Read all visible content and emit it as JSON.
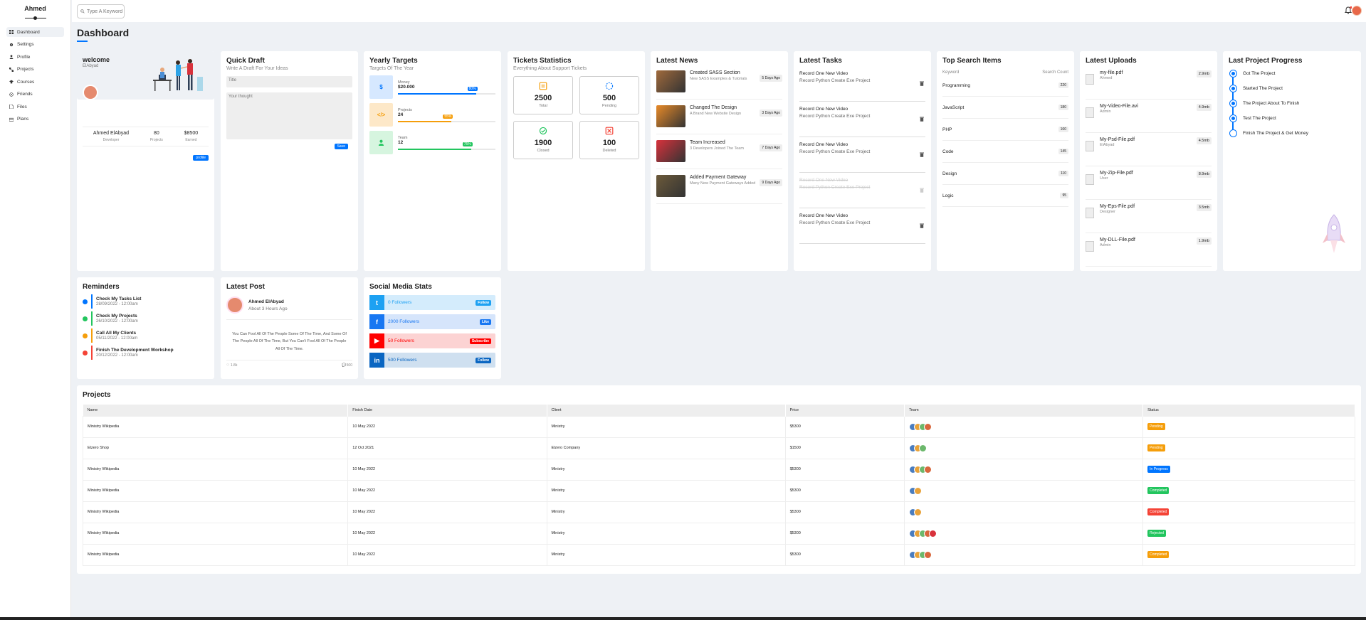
{
  "sidebar": {
    "brand": "Ahmed",
    "items": [
      {
        "label": "Dashboard",
        "icon": "dashboard-icon"
      },
      {
        "label": "Settings",
        "icon": "gear-icon"
      },
      {
        "label": "Profile",
        "icon": "user-icon"
      },
      {
        "label": "Projects",
        "icon": "projects-icon"
      },
      {
        "label": "Courses",
        "icon": "graduation-cap-icon"
      },
      {
        "label": "Friends",
        "icon": "friends-icon"
      },
      {
        "label": "Files",
        "icon": "file-icon"
      },
      {
        "label": "Plans",
        "icon": "credit-card-icon"
      }
    ]
  },
  "topbar": {
    "search_placeholder": "Type A Keyword"
  },
  "page_title": "Dashboard",
  "welcome": {
    "title": "welcome",
    "name": "ElAbyad",
    "stats": [
      {
        "v": "Ahmed ElAbyad",
        "l": "Developer"
      },
      {
        "v": "80",
        "l": "Projects"
      },
      {
        "v": "$8500",
        "l": "Earned"
      }
    ],
    "button": "profile"
  },
  "quick_draft": {
    "title": "Quick Draft",
    "sub": "Write A Draft For Your Ideas",
    "title_placeholder": "Title",
    "body_placeholder": "Your thought",
    "button": "Save"
  },
  "yearly": {
    "title": "Yearly Targets",
    "sub": "Targets Of The Year",
    "rows": [
      {
        "label": "Money",
        "value": "$20.000",
        "pct": "80%",
        "color": "#0075ff",
        "bg": "#d6e8ff",
        "icon": "$"
      },
      {
        "label": "Projects",
        "value": "24",
        "pct": "55%",
        "color": "#f59e0b",
        "bg": "#fde8c8",
        "icon": "</>"
      },
      {
        "label": "Team",
        "value": "12",
        "pct": "75%",
        "color": "#22c55e",
        "bg": "#d6f5df",
        "icon": "person"
      }
    ]
  },
  "tickets": {
    "title": "Tickets Statistics",
    "sub": "Everything About Support Tickets",
    "items": [
      {
        "num": "2500",
        "label": "Total",
        "color": "#f59e0b"
      },
      {
        "num": "500",
        "label": "Pending",
        "color": "#0075ff"
      },
      {
        "num": "1900",
        "label": "Closed",
        "color": "#22c55e"
      },
      {
        "num": "100",
        "label": "Deleted",
        "color": "#f44336"
      }
    ]
  },
  "news": {
    "title": "Latest News",
    "items": [
      {
        "t": "Created SASS Section",
        "d": "New SASS Examples & Tutorials",
        "ago": "5 Days Ago",
        "img": "#a06a3c"
      },
      {
        "t": "Changed The Design",
        "d": "A Brand New Website Design",
        "ago": "3 Days Ago",
        "img": "#e88a28"
      },
      {
        "t": "Team Increased",
        "d": "3 Developers Joined The Team",
        "ago": "7 Days Ago",
        "img": "#d8323c"
      },
      {
        "t": "Added Payment Gateway",
        "d": "Many New Payment Gateways Added",
        "ago": "9 Days Ago",
        "img": "#6c5a3a"
      }
    ]
  },
  "tasks": {
    "title": "Latest Tasks",
    "items": [
      {
        "a": "Record One New Video",
        "b": "Record Python Create Exe Project",
        "done": false
      },
      {
        "a": "Record One New Video",
        "b": "Record Python Create Exe Project",
        "done": false
      },
      {
        "a": "Record One New Video",
        "b": "Record Python Create Exe Project",
        "done": false
      },
      {
        "a": "Record One New Video",
        "b": "Record Python Create Exe Project",
        "done": true
      },
      {
        "a": "Record One New Video",
        "b": "Record Python Create Exe Project",
        "done": false
      }
    ]
  },
  "search_items": {
    "title": "Top Search Items",
    "col1": "Keyword",
    "col2": "Search Count",
    "rows": [
      {
        "k": "Programming",
        "c": "220"
      },
      {
        "k": "JavaScript",
        "c": "180"
      },
      {
        "k": "PHP",
        "c": "160"
      },
      {
        "k": "Code",
        "c": "145"
      },
      {
        "k": "Design",
        "c": "110"
      },
      {
        "k": "Logic",
        "c": "95"
      }
    ]
  },
  "uploads": {
    "title": "Latest Uploads",
    "rows": [
      {
        "n": "my-file.pdf",
        "u": "Ahmed",
        "s": "2.9mb",
        "ext": "PDF",
        "c": "#f44336"
      },
      {
        "n": "My-Video-File.avi",
        "u": "Admin",
        "s": "4.9mb",
        "ext": "AVI",
        "c": "#f44336"
      },
      {
        "n": "My-Psd-File.pdf",
        "u": "ElAbyad",
        "s": "4.5mb",
        "ext": "PSD",
        "c": "#2ea3e6"
      },
      {
        "n": "My-Zip-File.pdf",
        "u": "User",
        "s": "8.9mb",
        "ext": "ZIP",
        "c": "#4caf50"
      },
      {
        "n": "My-Eps-File.pdf",
        "u": "Designer",
        "s": "3.5mb",
        "ext": "EPS",
        "c": "#f44336"
      },
      {
        "n": "My-DLL-File.pdf",
        "u": "Admin",
        "s": "1.9mb",
        "ext": "DLL",
        "c": "#f59e0b"
      }
    ]
  },
  "progress": {
    "title": "Last Project Progress",
    "items": [
      {
        "t": "Got The Project",
        "done": true
      },
      {
        "t": "Started The Project",
        "done": true
      },
      {
        "t": "The Project About To Finish",
        "done": true
      },
      {
        "t": "Test The Project",
        "done": true
      },
      {
        "t": "Finish The Project & Get Money",
        "done": false
      }
    ]
  },
  "reminders": {
    "title": "Reminders",
    "items": [
      {
        "t": "Check My Tasks List",
        "d": "28/09/2022 - 12:00am",
        "c": "#0075ff"
      },
      {
        "t": "Check My Projects",
        "d": "26/10/2022 - 12:00am",
        "c": "#22c55e"
      },
      {
        "t": "Call All My Clients",
        "d": "05/11/2022 - 12:00am",
        "c": "#f59e0b"
      },
      {
        "t": "Finish The Development Workshop",
        "d": "20/12/2022 - 12:00am",
        "c": "#f44336"
      }
    ]
  },
  "latest_post": {
    "title": "Latest Post",
    "name": "Ahmed ElAbyad",
    "time": "About 3 Hours Ago",
    "body": "You Can Fool All Of The People Some Of The Time, And Some Of The People All Of The Time, But You Can't Fool All Of The People All Of The Time.",
    "likes": "1.8k",
    "comments": "500"
  },
  "social": {
    "title": "Social Media Stats",
    "rows": [
      {
        "t": "0 Followers",
        "b": "Follow",
        "c": "#1da1f2",
        "bg": "#d4ecfc",
        "ic": "t"
      },
      {
        "t": "2000 Followers",
        "b": "Like",
        "c": "#1877f2",
        "bg": "#d6e5fb",
        "ic": "f"
      },
      {
        "t": "50 Followers",
        "b": "Subscribe",
        "c": "#ff0000",
        "bg": "#fcd3d3",
        "ic": "▶"
      },
      {
        "t": "500 Followers",
        "b": "Follow",
        "c": "#0a66c2",
        "bg": "#cfe0f0",
        "ic": "in"
      }
    ]
  },
  "projects": {
    "title": "Projects",
    "headers": [
      "Name",
      "Finish Date",
      "Client",
      "Price",
      "Team",
      "Status"
    ],
    "rows": [
      {
        "n": "Ministry Wikipedia",
        "d": "10 May 2022",
        "c": "Ministry",
        "p": "$5300",
        "team": 4,
        "s": "Pending",
        "sc": "#f59e0b"
      },
      {
        "n": "Elzero Shop",
        "d": "12 Oct 2021",
        "c": "Elzero Company",
        "p": "$1500",
        "team": 3,
        "s": "Pending",
        "sc": "#f59e0b"
      },
      {
        "n": "Ministry Wikipedia",
        "d": "10 May 2022",
        "c": "Ministry",
        "p": "$5300",
        "team": 4,
        "s": "In Progress",
        "sc": "#0075ff"
      },
      {
        "n": "Ministry Wikipedia",
        "d": "10 May 2022",
        "c": "Ministry",
        "p": "$5300",
        "team": 2,
        "s": "Completed",
        "sc": "#22c55e"
      },
      {
        "n": "Ministry Wikipedia",
        "d": "10 May 2022",
        "c": "Ministry",
        "p": "$5300",
        "team": 2,
        "s": "Completed",
        "sc": "#f44336"
      },
      {
        "n": "Ministry Wikipedia",
        "d": "10 May 2022",
        "c": "Ministry",
        "p": "$5300",
        "team": 5,
        "s": "Rejected",
        "sc": "#22c55e"
      },
      {
        "n": "Ministry Wikipedia",
        "d": "10 May 2022",
        "c": "Ministry",
        "p": "$5300",
        "team": 4,
        "s": "Completed",
        "sc": "#f59e0b"
      }
    ]
  }
}
